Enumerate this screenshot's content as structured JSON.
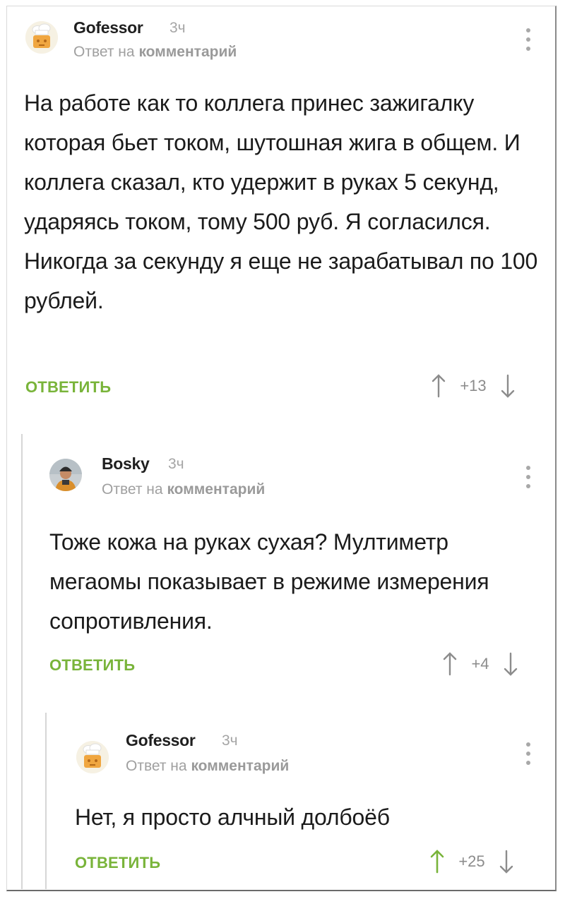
{
  "comments": [
    {
      "author": "Gofessor",
      "time": "3ч",
      "reply_prefix": "Ответ на",
      "reply_link": "комментарий",
      "text": "На работе как то коллега принес зажигалку которая бьет током, шутошная жига в общем. И коллега сказал, кто удержит в руках 5 секунд, ударяясь током, тому 500 руб. Я согласился. Никогда за секунду я еще не зарабатывал по 100 рублей.",
      "reply_label": "ОТВЕТИТЬ",
      "score": "+13"
    },
    {
      "author": "Bosky",
      "time": "3ч",
      "reply_prefix": "Ответ на",
      "reply_link": "комментарий",
      "text": "Тоже кожа на руках сухая? Мултиметр мегаомы показывает в режиме измерения сопротивления.",
      "reply_label": "ОТВЕТИТЬ",
      "score": "+4"
    },
    {
      "author": "Gofessor",
      "time": "3ч",
      "reply_prefix": "Ответ на",
      "reply_link": "комментарий",
      "text": "Нет, я просто алчный долбоёб",
      "reply_label": "ОТВЕТИТЬ",
      "score": "+25",
      "upvoted": true
    }
  ],
  "colors": {
    "accent_green": "#79b43a",
    "upvote_active": "#79b43a",
    "arrow_inactive": "#8c8c8c",
    "muted_text": "#a0a0a0"
  },
  "icons": [
    "chef-hat-avatar",
    "person-photo-avatar",
    "more-vertical-icon",
    "arrow-up-icon",
    "arrow-down-icon"
  ]
}
